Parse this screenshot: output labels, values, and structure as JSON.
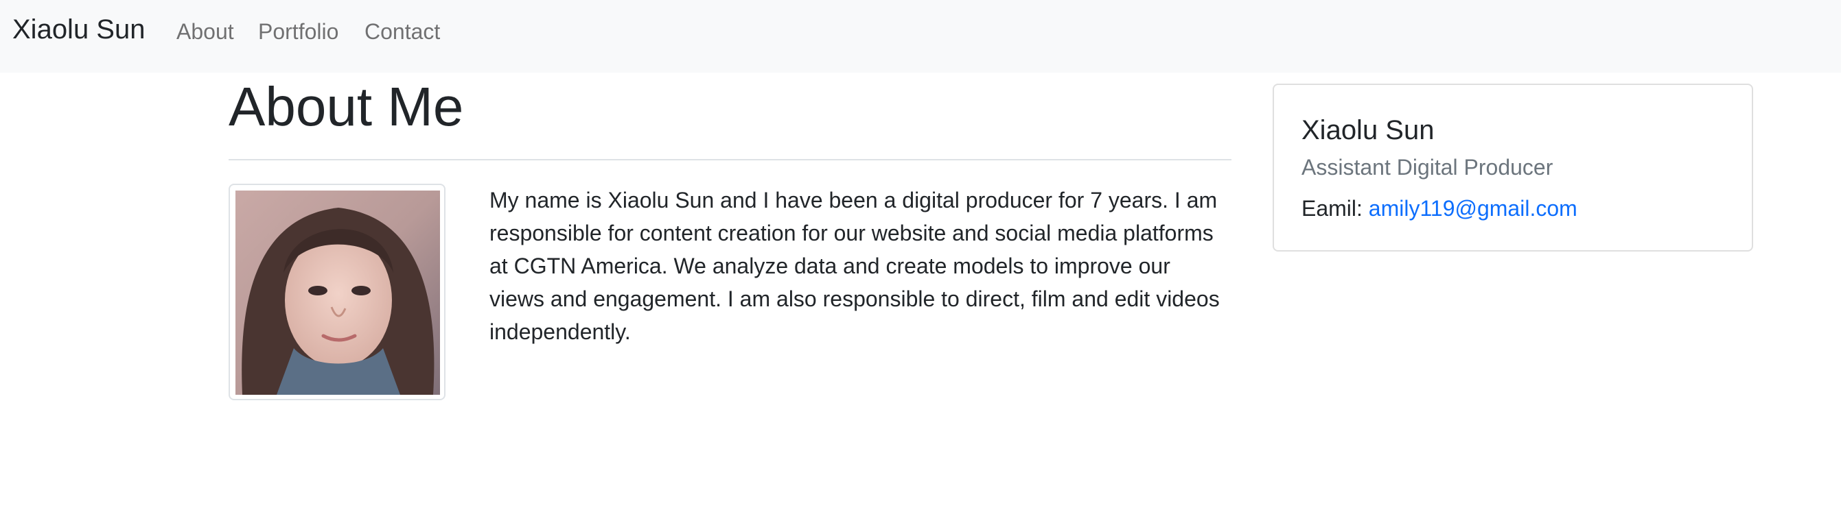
{
  "navbar": {
    "brand": "Xiaolu Sun",
    "links": [
      "About",
      "Portfolio",
      "Contact"
    ]
  },
  "main": {
    "heading": "About Me",
    "photo_alt": "Portrait photo",
    "bio": "My name is Xiaolu Sun and I have been a digital producer for 7 years. I am responsible for content creation for our website and social media platforms at CGTN America. We analyze data and create models to improve our views and engagement. I am also responsible to direct, film and edit videos independently."
  },
  "card": {
    "name": "Xiaolu Sun",
    "title": "Assistant Digital Producer",
    "email_label": "Eamil:",
    "email": "amily119@gmail.com"
  },
  "colors": {
    "navbar_bg": "#f8f9fa",
    "link_primary": "#0d6efd",
    "muted": "#6c757d"
  }
}
